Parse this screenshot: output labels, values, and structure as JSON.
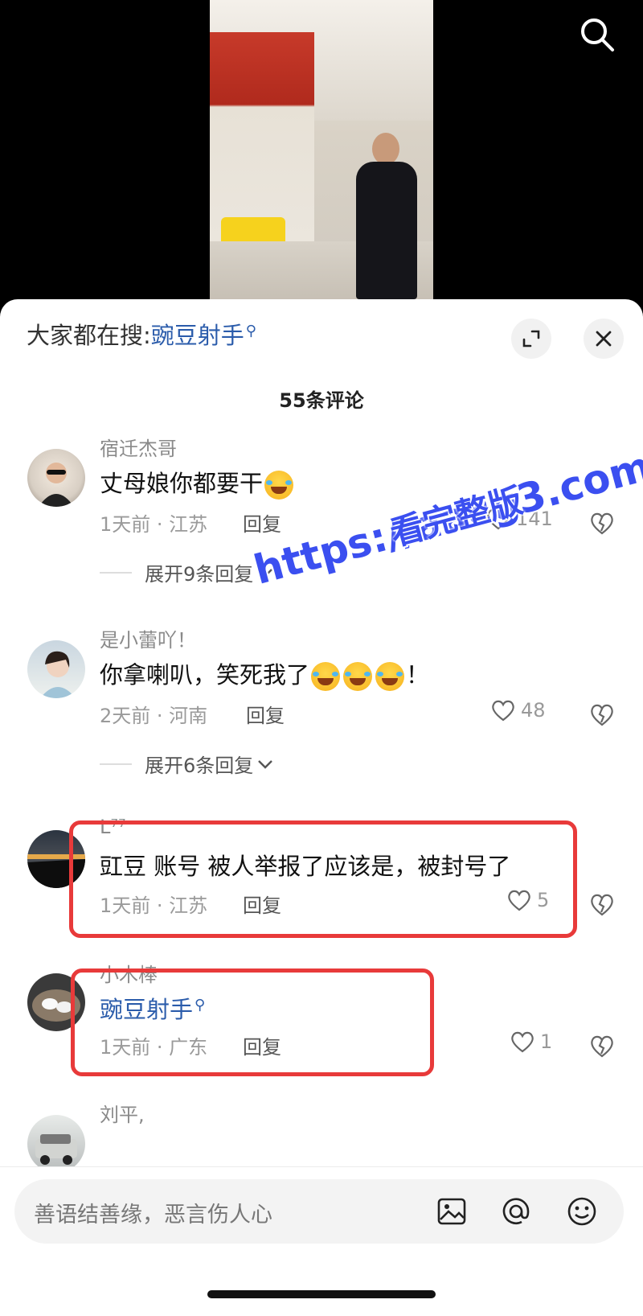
{
  "video": {
    "search_icon": "search-icon"
  },
  "header": {
    "hot_search_prefix": "大家都在搜:",
    "hot_search_term": "豌豆射手",
    "expand_icon": "expand-icon",
    "close_icon": "close-icon"
  },
  "comment_count": "55条评论",
  "comments": [
    {
      "name": "宿迁杰哥",
      "text": "丈母娘你都要干",
      "emojis": 1,
      "time_loc": "1天前 · 江苏",
      "reply": "回复",
      "likes": "141",
      "expand": "展开9条回复"
    },
    {
      "name": "是小蕾吖！",
      "text": "你拿喇叭，笑死我了",
      "emojis": 3,
      "text_suffix": "！",
      "time_loc": "2天前 · 河南",
      "reply": "回复",
      "likes": "48",
      "expand": "展开6条回复"
    },
    {
      "name": "L⁷⁷",
      "text": "豇豆 账号 被人举报了应该是，被封号了",
      "time_loc": "1天前 · 江苏",
      "reply": "回复",
      "likes": "5"
    },
    {
      "name": "小木棒",
      "text": "豌豆射手",
      "time_loc": "1天前 · 广东",
      "reply": "回复",
      "likes": "1"
    },
    {
      "name": "刘平,"
    }
  ],
  "watermark": {
    "line1": "https://aacg3.com",
    "line2": "看完整版"
  },
  "input": {
    "placeholder": "善语结善缘，恶言伤人心",
    "icons": [
      "image-icon",
      "at-icon",
      "emoji-icon"
    ]
  },
  "colors": {
    "link": "#2b5cab",
    "highlight": "#e83a3a",
    "watermark": "#3b4ff0"
  }
}
